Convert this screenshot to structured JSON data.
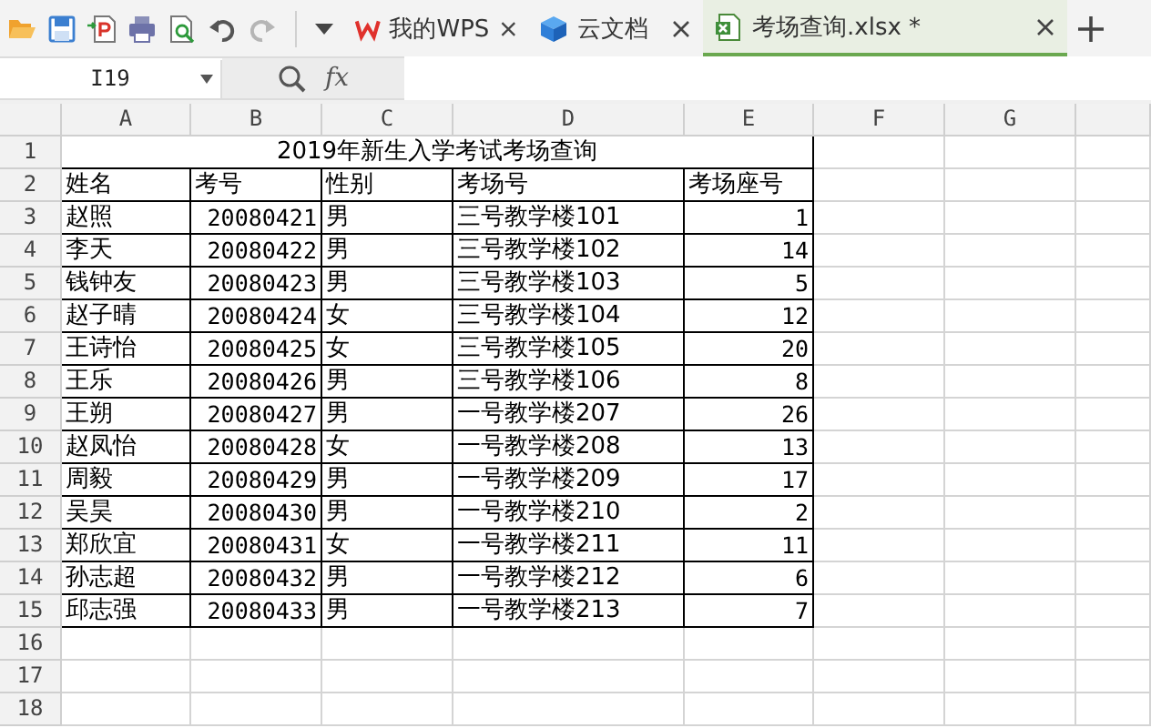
{
  "toolbar": {
    "redo_disabled": true
  },
  "tabs": [
    {
      "label": "我的WPS",
      "kind": "wps",
      "selected": false
    },
    {
      "label": "云文档",
      "kind": "cloud",
      "selected": false
    },
    {
      "label": "考场查询.xlsx *",
      "kind": "sheet",
      "selected": true
    }
  ],
  "name_box": "I19",
  "formula_label": "fx",
  "column_headers": [
    "A",
    "B",
    "C",
    "D",
    "E",
    "F",
    "G"
  ],
  "row_numbers": [
    "1",
    "2",
    "3",
    "4",
    "5",
    "6",
    "7",
    "8",
    "9",
    "10",
    "11",
    "12",
    "13",
    "14",
    "15",
    "16",
    "17",
    "18"
  ],
  "title": "2019年新生入学考试考场查询",
  "header": [
    "姓名",
    "考号",
    "性别",
    "考场号",
    "考场座号"
  ],
  "rows": [
    [
      "赵照",
      "20080421",
      "男",
      "三号教学楼101",
      "1"
    ],
    [
      "李天",
      "20080422",
      "男",
      "三号教学楼102",
      "14"
    ],
    [
      "钱钟友",
      "20080423",
      "男",
      "三号教学楼103",
      "5"
    ],
    [
      "赵子晴",
      "20080424",
      "女",
      "三号教学楼104",
      "12"
    ],
    [
      "王诗怡",
      "20080425",
      "女",
      "三号教学楼105",
      "20"
    ],
    [
      "王乐",
      "20080426",
      "男",
      "三号教学楼106",
      "8"
    ],
    [
      "王朔",
      "20080427",
      "男",
      "一号教学楼207",
      "26"
    ],
    [
      "赵凤怡",
      "20080428",
      "女",
      "一号教学楼208",
      "13"
    ],
    [
      "周毅",
      "20080429",
      "男",
      "一号教学楼209",
      "17"
    ],
    [
      "吴昊",
      "20080430",
      "男",
      "一号教学楼210",
      "2"
    ],
    [
      "郑欣宜",
      "20080431",
      "女",
      "一号教学楼211",
      "11"
    ],
    [
      "孙志超",
      "20080432",
      "男",
      "一号教学楼212",
      "6"
    ],
    [
      "邱志强",
      "20080433",
      "男",
      "一号教学楼213",
      "7"
    ]
  ]
}
